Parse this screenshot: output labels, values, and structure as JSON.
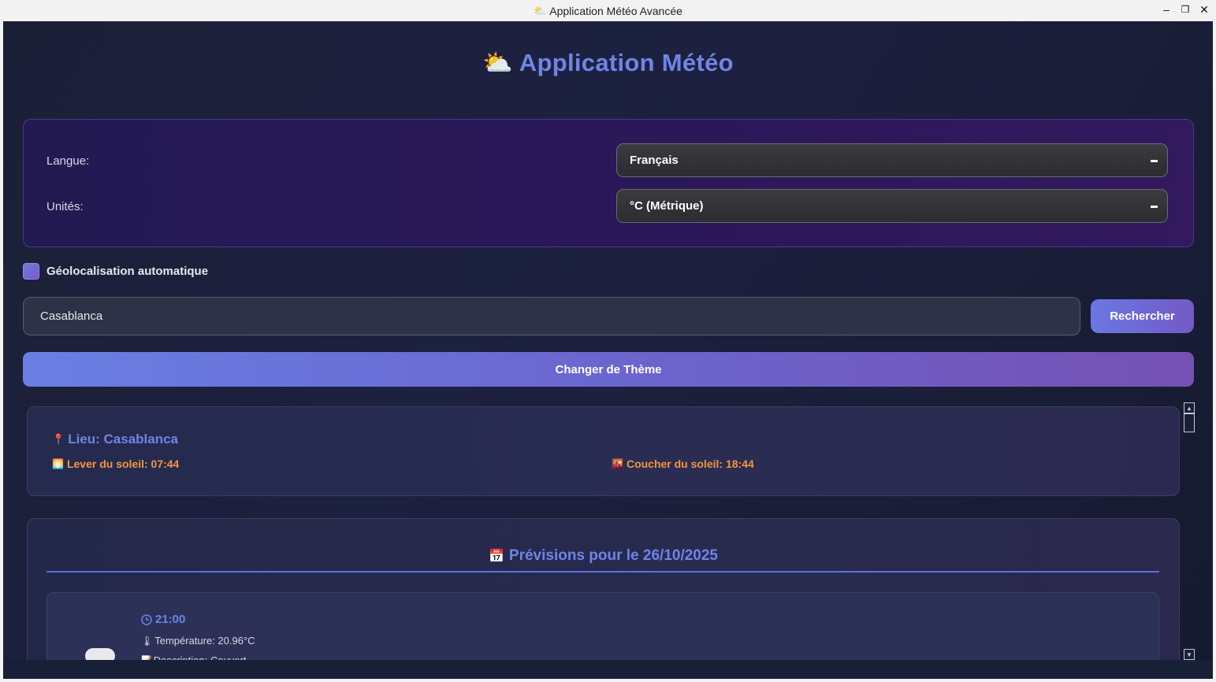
{
  "window": {
    "title": "Application Météo Avancée",
    "controls": {
      "minimize": "–",
      "maximize": "❐",
      "close": "✕"
    }
  },
  "header": {
    "title": "Application Météo",
    "icon": "sun-cloud-icon"
  },
  "settings": {
    "language_label": "Langue:",
    "language_value": "Français",
    "units_label": "Unités:",
    "units_value": "°C (Métrique)"
  },
  "geolocation": {
    "label": "Géolocalisation automatique",
    "checked": false
  },
  "search": {
    "value": "Casablanca",
    "button_label": "Rechercher"
  },
  "theme_button": {
    "label": "Changer de Thème"
  },
  "location_card": {
    "location": "Lieu: Casablanca",
    "sunrise": "Lever du soleil: 07:44",
    "sunset": "Coucher du soleil: 18:44"
  },
  "forecast": {
    "title": "Prévisions pour le 26/10/2025",
    "items": [
      {
        "time": "21:00",
        "temperature": "Température: 20.96°C",
        "description": "Description: Couvert"
      }
    ]
  },
  "colors": {
    "accent": "#6f84e6",
    "sun_orange": "#f2973f",
    "background": "#1b1f36",
    "settings_panel": "#2a1858"
  }
}
